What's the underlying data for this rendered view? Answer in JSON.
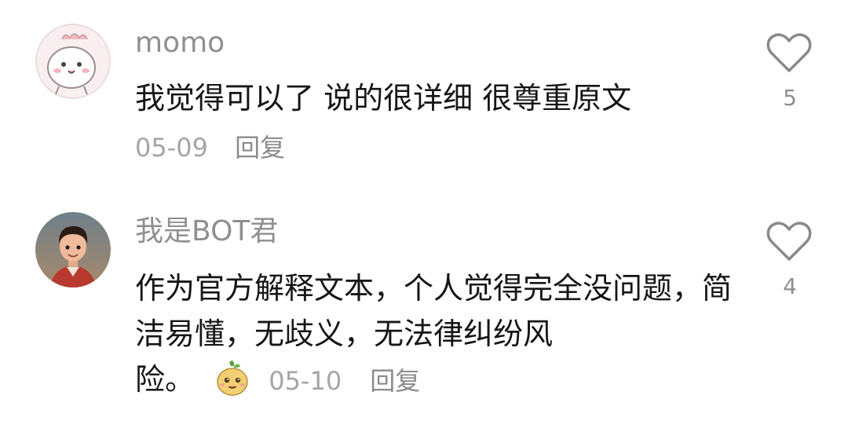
{
  "comments": [
    {
      "username": "momo",
      "avatar": "pink-dinosaur-avatar",
      "text": "我觉得可以了 说的很详细 很尊重原文",
      "date": "05-09",
      "reply_label": "回复",
      "likes": "5",
      "like_icon": "heart-outline-icon"
    },
    {
      "username": "我是BOT君",
      "avatar": "cartoon-boy-avatar",
      "text": "作为官方解释文本，个人觉得完全没问题，简洁易懂，无歧义，无法律纠纷风",
      "text_tail": "险。",
      "emoji": "potato-emoji",
      "date": "05-10",
      "reply_label": "回复",
      "likes": "4",
      "like_icon": "heart-outline-icon"
    }
  ]
}
